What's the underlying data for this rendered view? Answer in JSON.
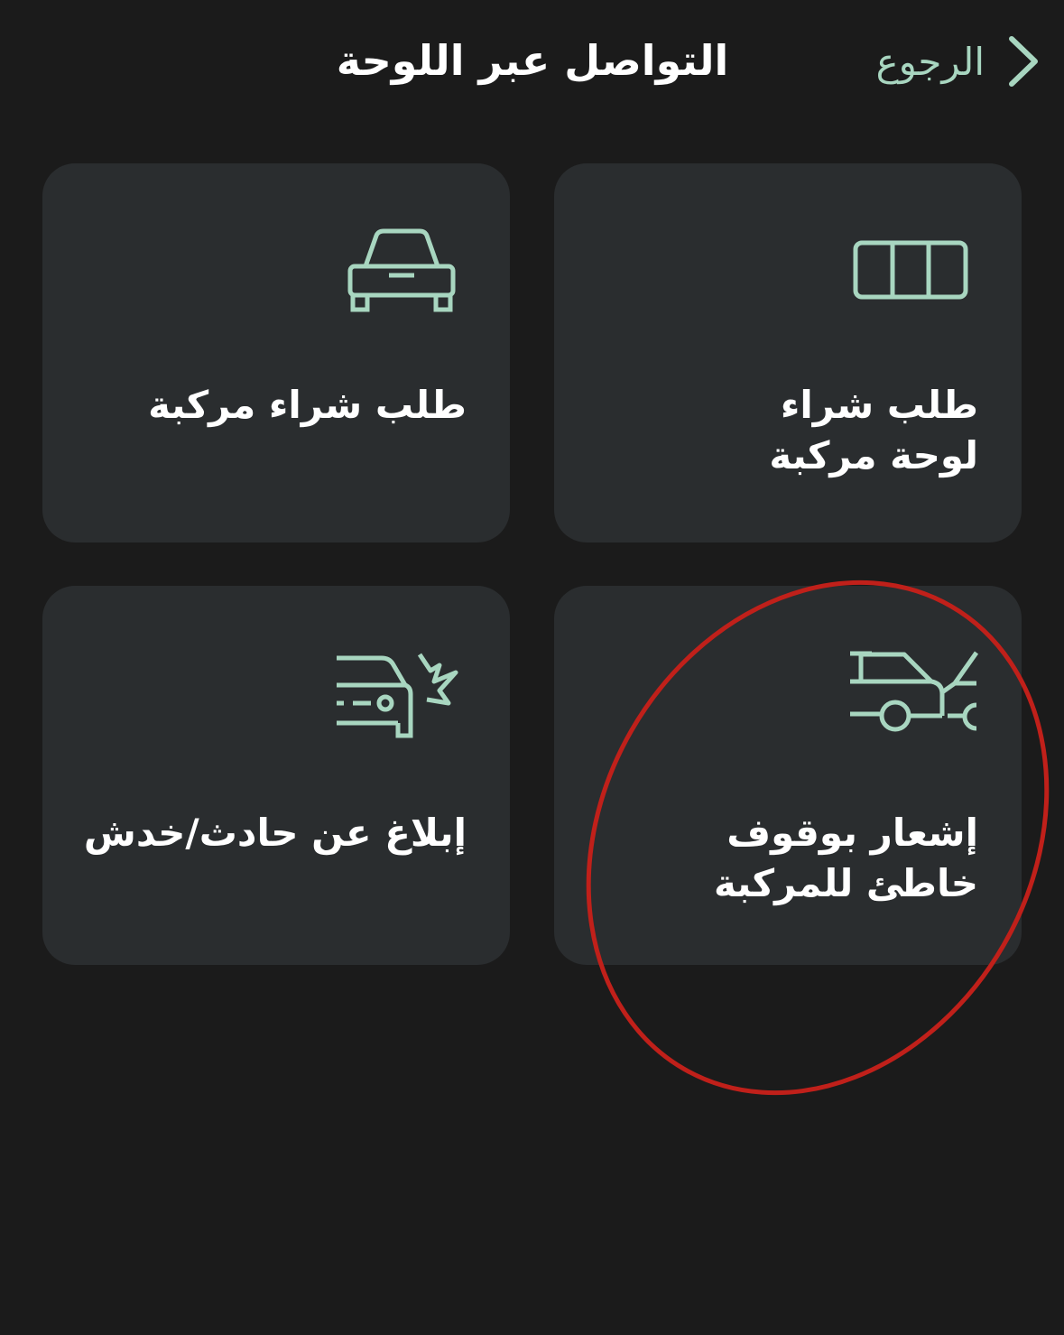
{
  "header": {
    "title": "التواصل عبر اللوحة",
    "back_label": "الرجوع"
  },
  "cards": [
    {
      "label": "طلب شراء\nلوحة مركبة",
      "icon": "license-plate-icon"
    },
    {
      "label": "طلب شراء مركبة",
      "icon": "car-front-icon"
    },
    {
      "label": "إشعار بوقوف\nخاطئ للمركبة",
      "icon": "blocked-car-icon"
    },
    {
      "label": "إبلاغ عن حادث/خدش",
      "icon": "car-crash-icon"
    }
  ],
  "colors": {
    "background": "#1b1b1b",
    "card": "#2a2d2f",
    "accent": "#a8d6c0",
    "text": "#ffffff",
    "annotation": "#c0201a"
  }
}
